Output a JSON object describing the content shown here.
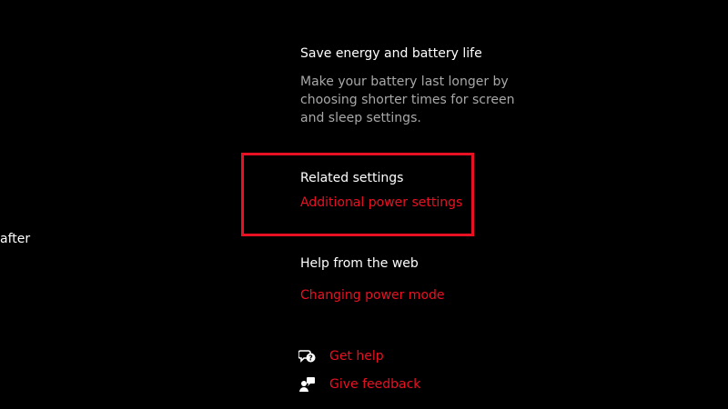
{
  "left_pane": {
    "clipped_text": "after"
  },
  "save_energy": {
    "title": "Save energy and battery life",
    "description": "Make your battery last longer by choosing shorter times for screen and sleep settings."
  },
  "related_settings": {
    "title": "Related settings",
    "link": "Additional power settings"
  },
  "help_web": {
    "title": "Help from the web",
    "link": "Changing power mode"
  },
  "actions": {
    "get_help": {
      "label": "Get help",
      "icon": "help-chat-icon"
    },
    "give_feedback": {
      "label": "Give feedback",
      "icon": "feedback-person-icon"
    }
  },
  "colors": {
    "background": "#000000",
    "text": "#ffffff",
    "secondary_text": "#a8a8a8",
    "accent": "#e81123",
    "highlight_border": "#e81123"
  }
}
